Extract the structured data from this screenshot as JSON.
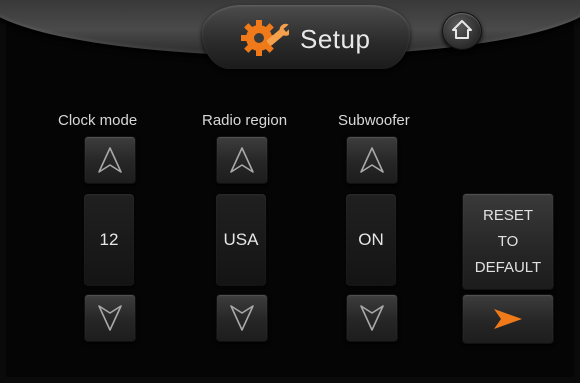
{
  "header": {
    "title": "Setup",
    "title_icon": "gear-wrench-icon",
    "home_icon": "home-icon"
  },
  "settings": [
    {
      "label": "Clock mode",
      "value": "12"
    },
    {
      "label": "Radio region",
      "value": "USA"
    },
    {
      "label": "Subwoofer",
      "value": "ON"
    }
  ],
  "reset": {
    "line1": "RESET",
    "line2": "TO",
    "line3": "DEFAULT"
  },
  "icons": {
    "up": "chevron-up-icon",
    "down": "chevron-down-icon",
    "next": "arrow-right-icon"
  },
  "colors": {
    "accent": "#f07a1a",
    "text": "#e6e6e6",
    "background": "#000000"
  }
}
